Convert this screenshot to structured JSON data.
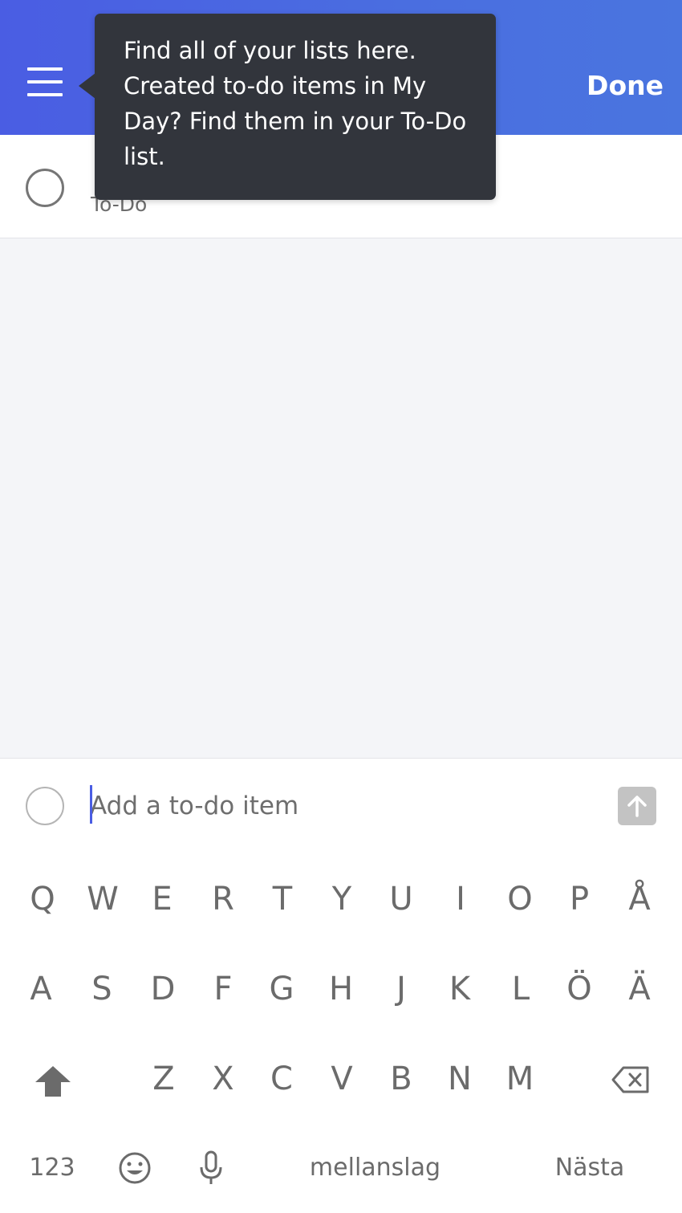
{
  "header": {
    "done_label": "Done"
  },
  "tooltip": {
    "text": "Find all of your lists here. Created to-do items in My Day? Find them in your To-Do list."
  },
  "task": {
    "title": "",
    "list_name": "To-Do"
  },
  "add_item": {
    "placeholder": "Add a to-do item",
    "value": ""
  },
  "keyboard": {
    "row1": [
      "Q",
      "W",
      "E",
      "R",
      "T",
      "Y",
      "U",
      "I",
      "O",
      "P",
      "Å"
    ],
    "row2": [
      "A",
      "S",
      "D",
      "F",
      "G",
      "H",
      "J",
      "K",
      "L",
      "Ö",
      "Ä"
    ],
    "row3": [
      "Z",
      "X",
      "C",
      "V",
      "B",
      "N",
      "M"
    ],
    "numbers_label": "123",
    "space_label": "mellanslag",
    "next_label": "Nästa"
  },
  "icons": {
    "menu": "hamburger-menu-icon",
    "send": "arrow-up-icon",
    "shift": "shift-icon",
    "backspace": "backspace-icon",
    "emoji": "emoji-icon",
    "mic": "microphone-icon"
  },
  "colors": {
    "accent": "#4a5de3",
    "tooltip_bg": "#32353c",
    "list_bg": "#f4f5f8"
  }
}
